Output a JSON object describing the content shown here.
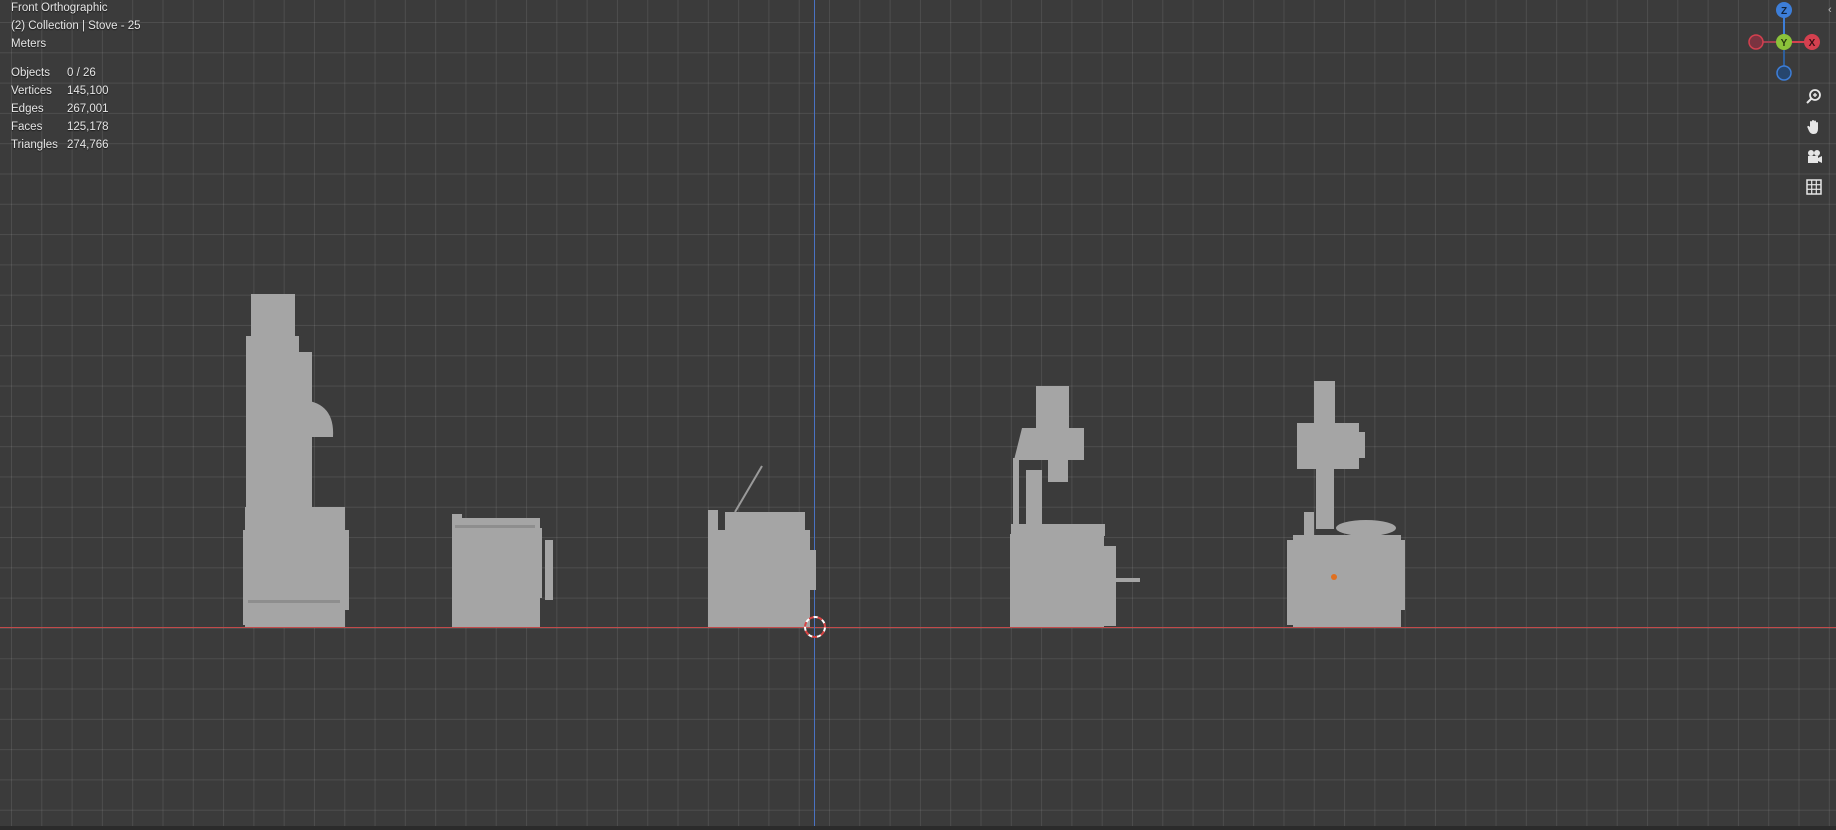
{
  "viewport": {
    "view_name": "Front Orthographic",
    "collection_line": "(2) Collection | Stove - 25",
    "units": "Meters"
  },
  "stats": [
    {
      "label": "Objects",
      "value": "0 / 26"
    },
    {
      "label": "Vertices",
      "value": "145,100"
    },
    {
      "label": "Edges",
      "value": "267,001"
    },
    {
      "label": "Faces",
      "value": "125,178"
    },
    {
      "label": "Triangles",
      "value": "274,766"
    }
  ],
  "gizmo": {
    "z_label": "Z",
    "y_label": "Y",
    "x_label": "X",
    "colors": {
      "x": "#d4404f",
      "y": "#8bc23a",
      "z": "#3d7ed8"
    }
  },
  "nav_icons": [
    "zoom-icon",
    "hand-pan-icon",
    "camera-icon",
    "ortho-grid-icon"
  ],
  "colors": {
    "background": "#3b3b3b",
    "x_axis": "#c24a4a",
    "z_axis": "#4a72c2",
    "object": "#a5a5a5"
  }
}
